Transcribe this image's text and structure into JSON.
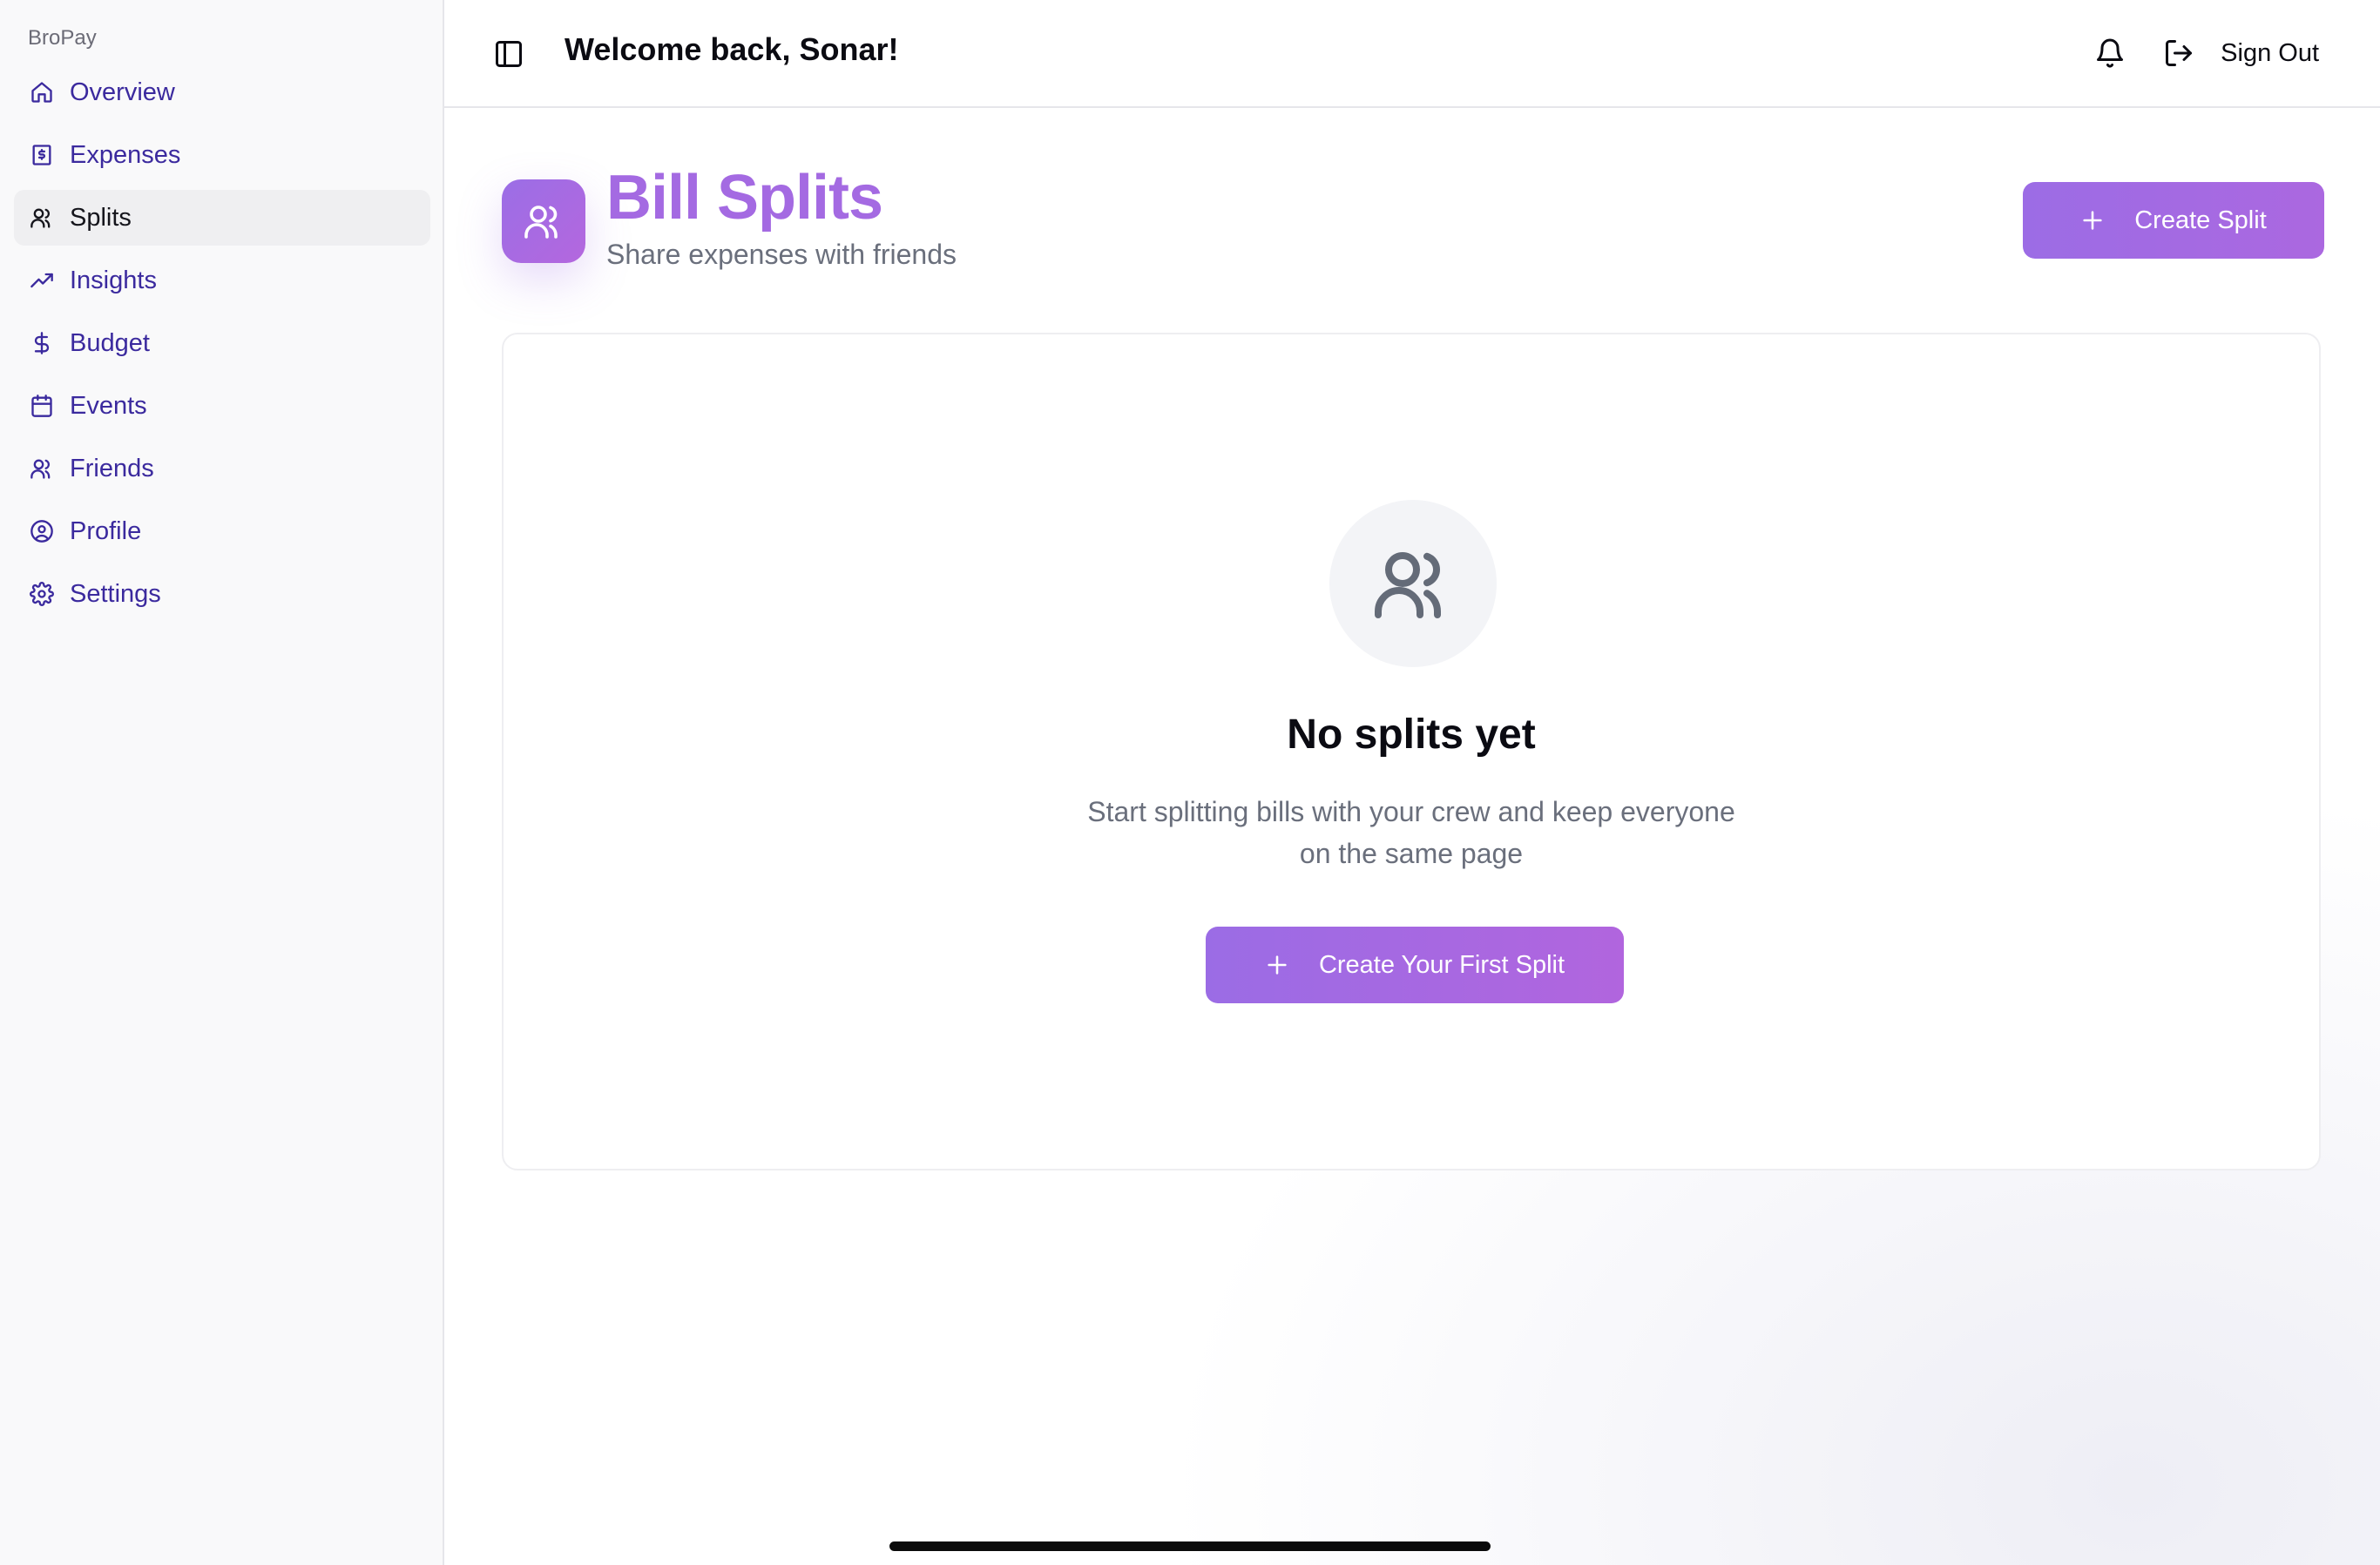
{
  "app": {
    "brand": "BroPay"
  },
  "sidebar": {
    "items": [
      {
        "label": "Overview",
        "icon": "home-icon",
        "active": false
      },
      {
        "label": "Expenses",
        "icon": "receipt-dollar-icon",
        "active": false
      },
      {
        "label": "Splits",
        "icon": "users-icon",
        "active": true
      },
      {
        "label": "Insights",
        "icon": "trending-up-icon",
        "active": false
      },
      {
        "label": "Budget",
        "icon": "dollar-sign-icon",
        "active": false
      },
      {
        "label": "Events",
        "icon": "calendar-icon",
        "active": false
      },
      {
        "label": "Friends",
        "icon": "users-icon",
        "active": false
      },
      {
        "label": "Profile",
        "icon": "user-circle-icon",
        "active": false
      },
      {
        "label": "Settings",
        "icon": "gear-icon",
        "active": false
      }
    ]
  },
  "header": {
    "welcome": "Welcome back, Sonar!",
    "sign_out": "Sign Out",
    "icons": [
      "sidebar-toggle-icon",
      "bell-icon",
      "log-out-icon"
    ]
  },
  "page": {
    "title": "Bill Splits",
    "subtitle": "Share expenses with friends",
    "create_button": "Create Split"
  },
  "empty_state": {
    "title": "No splits yet",
    "text_line1": "Start splitting bills with your crew and keep everyone",
    "text_line2": "on the same page",
    "button": "Create Your First Split"
  },
  "colors": {
    "accent": "#a46ae2",
    "nav_text": "#3b2a9e",
    "muted_text": "#6a6f7c"
  }
}
